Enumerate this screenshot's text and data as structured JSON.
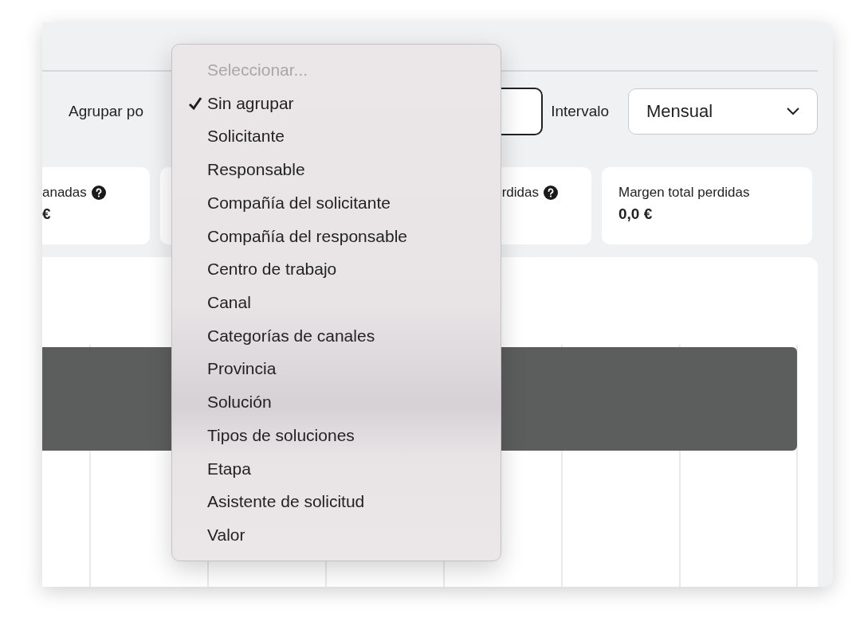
{
  "toolbar": {
    "group_label": "Agrupar po",
    "interval_label": "Intervalo",
    "interval_select": {
      "value": "Mensual"
    }
  },
  "stats": [
    {
      "kind": "stat",
      "label": "anadas",
      "help": true,
      "value": "€"
    },
    {
      "kind": "blank"
    },
    {
      "kind": "stat",
      "label": "rdidas",
      "help": true
    },
    {
      "kind": "stat",
      "label": "Margen total perdidas",
      "help": false,
      "value": "0,0 €"
    }
  ],
  "dropdown": {
    "prompt": "Seleccionar...",
    "options": [
      {
        "label": "Sin agrupar",
        "selected": true
      },
      {
        "label": "Solicitante",
        "selected": false
      },
      {
        "label": "Responsable",
        "selected": false
      },
      {
        "label": "Compañía del solicitante",
        "selected": false
      },
      {
        "label": "Compañía del responsable",
        "selected": false
      },
      {
        "label": "Centro de trabajo",
        "selected": false
      },
      {
        "label": "Canal",
        "selected": false
      },
      {
        "label": "Categorías de canales",
        "selected": false
      },
      {
        "label": "Provincia",
        "selected": false
      },
      {
        "label": "Solución",
        "selected": false
      },
      {
        "label": "Tipos de soluciones",
        "selected": false
      },
      {
        "label": "Etapa",
        "selected": false
      },
      {
        "label": "Asistente de solicitud",
        "selected": false
      },
      {
        "label": "Valor",
        "selected": false
      }
    ]
  }
}
